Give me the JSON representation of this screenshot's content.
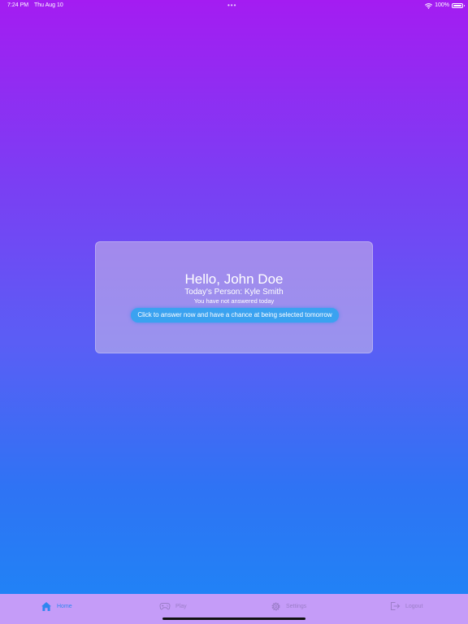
{
  "status_bar": {
    "time": "7:24 PM",
    "date": "Thu Aug 10",
    "center_dots": "•••",
    "battery_text": "100%"
  },
  "card": {
    "greeting": "Hello, John Doe",
    "person_line": "Today's Person: Kyle Smith",
    "status_line": "You have not answered today",
    "button_label": "Click to answer now and have a chance at being selected tomorrow"
  },
  "tab_bar": {
    "items": [
      {
        "label": "Home",
        "icon": "house-icon",
        "selected": true
      },
      {
        "label": "Play",
        "icon": "gamepad-icon",
        "selected": false
      },
      {
        "label": "Settings",
        "icon": "gear-icon",
        "selected": false
      },
      {
        "label": "Logout",
        "icon": "logout-icon",
        "selected": false
      }
    ]
  },
  "colors": {
    "gradient_top": "#a41cf2",
    "gradient_bottom": "#1d86f6",
    "tab_bar_bg": "#c59cf8",
    "accent_blue": "#2f86f0",
    "button_blue": "#3aa2f0"
  }
}
